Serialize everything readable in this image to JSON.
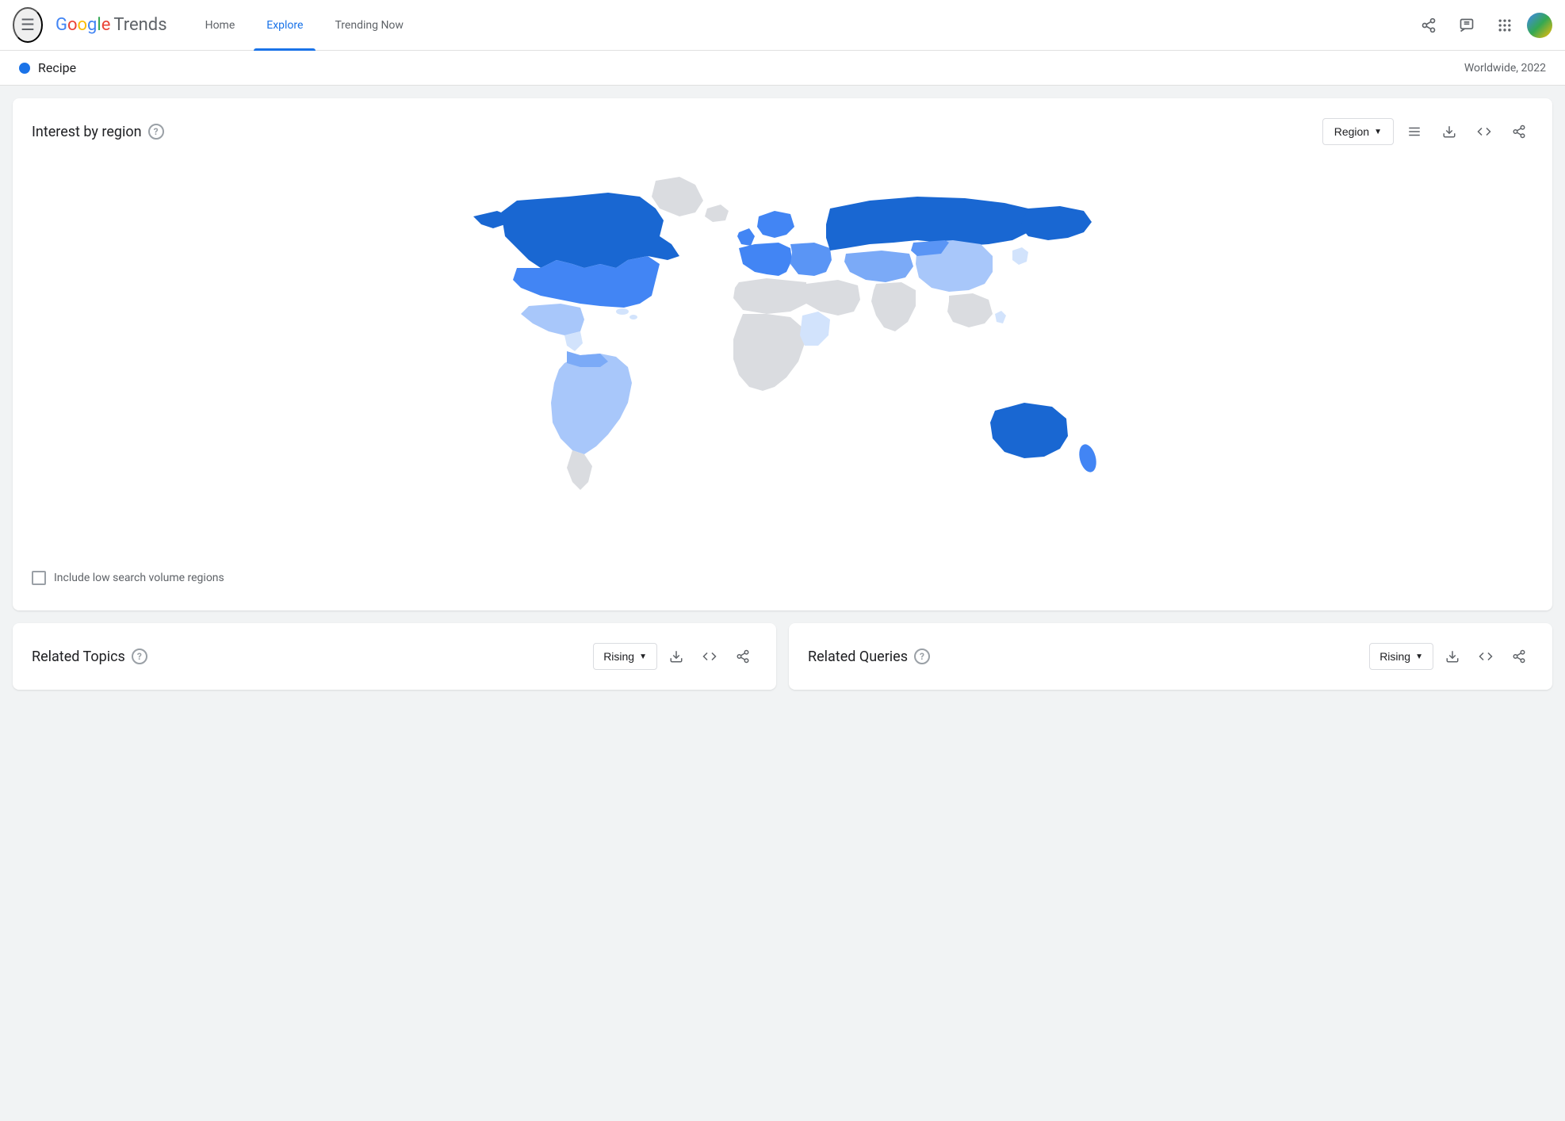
{
  "header": {
    "hamburger_label": "☰",
    "logo_google": "Google",
    "logo_trends": "Trends",
    "nav": [
      {
        "id": "home",
        "label": "Home",
        "active": false
      },
      {
        "id": "explore",
        "label": "Explore",
        "active": true
      },
      {
        "id": "trending",
        "label": "Trending Now",
        "active": false
      }
    ],
    "icons": {
      "share": "share",
      "feedback": "feedback",
      "apps": "apps"
    }
  },
  "sub_header": {
    "search_term": "Recipe",
    "geo_time": "Worldwide, 2022"
  },
  "interest_by_region": {
    "title": "Interest by region",
    "help_label": "?",
    "region_dropdown_label": "Region",
    "dropdown_arrow": "▼",
    "checkbox_label": "Include low search volume regions"
  },
  "related_topics": {
    "title": "Related Topics",
    "help_label": "?",
    "dropdown_label": "Rising",
    "dropdown_arrow": "▼"
  },
  "related_queries": {
    "title": "Related Queries",
    "help_label": "?",
    "dropdown_label": "Rising",
    "dropdown_arrow": "▼"
  },
  "map": {
    "dark_blue": "#1a73e8",
    "medium_blue": "#4285F4",
    "light_blue": "#a8c7fa",
    "very_light_blue": "#d2e3fc",
    "gray": "#dadce0"
  }
}
